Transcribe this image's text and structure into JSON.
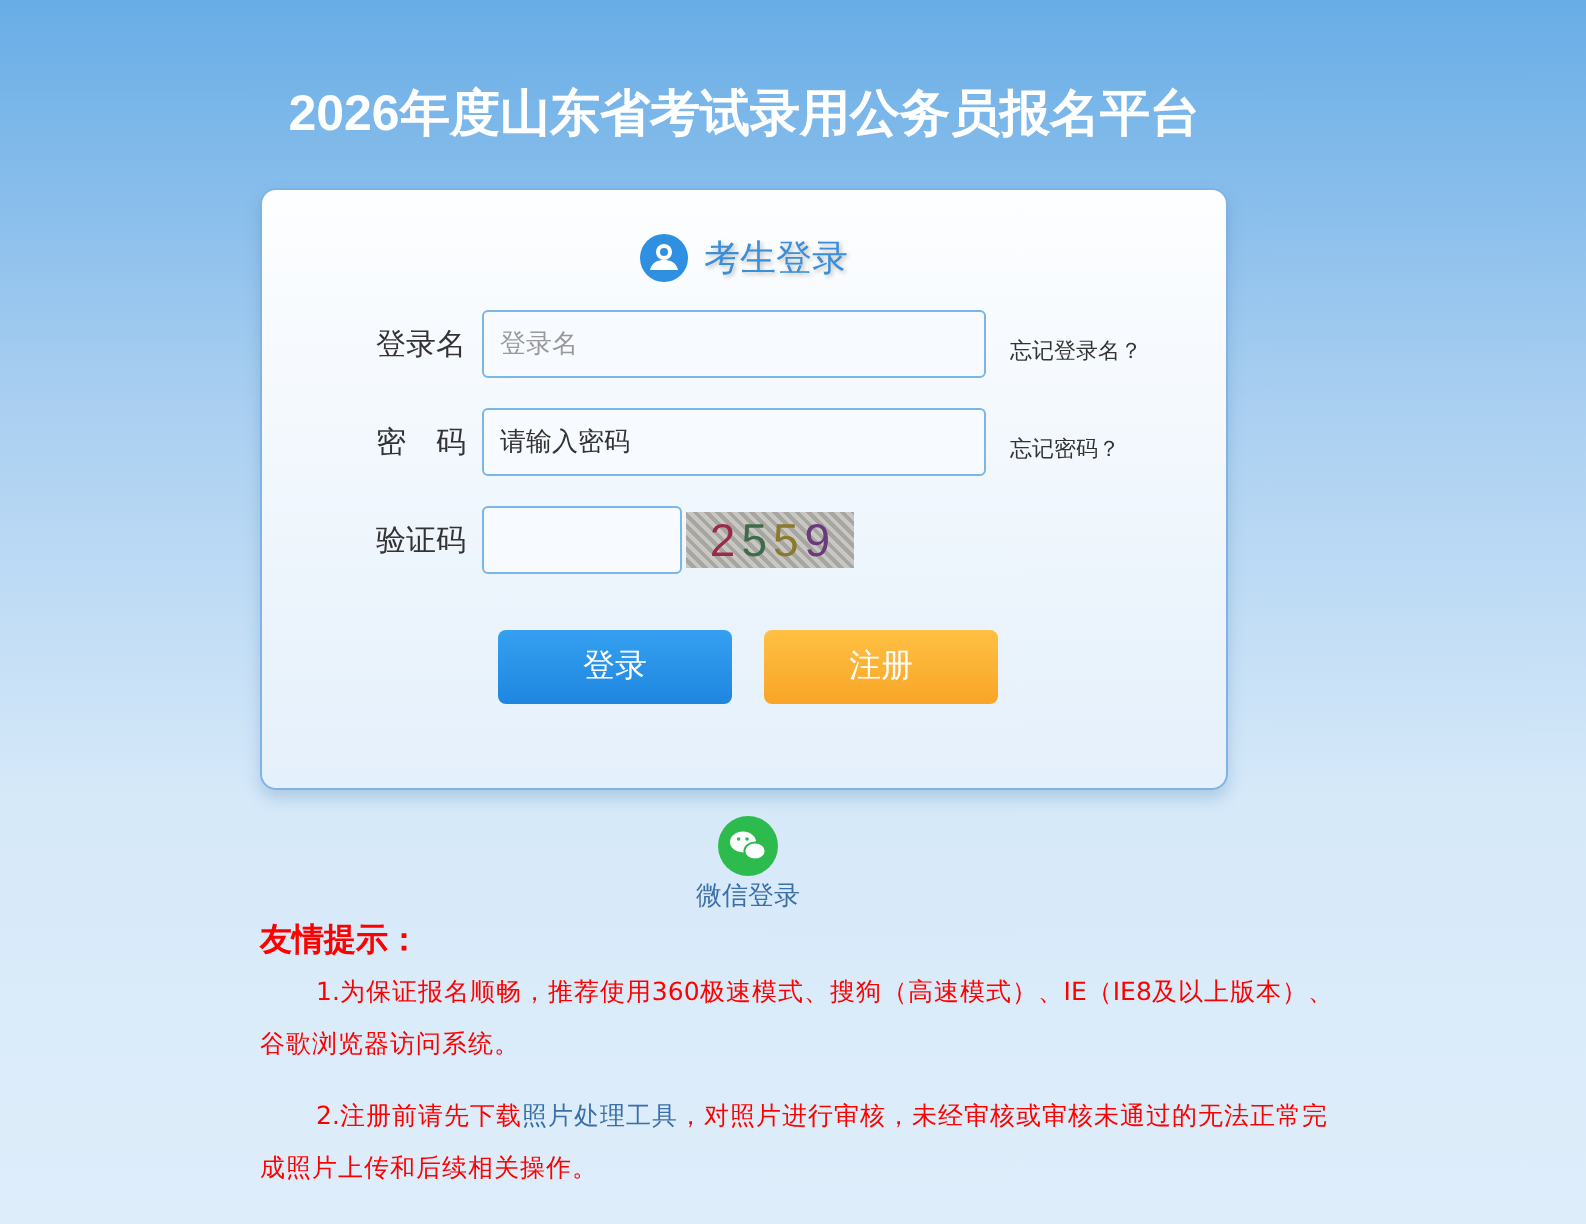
{
  "page_title": "2026年度山东省考试录用公务员报名平台",
  "login": {
    "heading": "考生登录",
    "fields": [
      {
        "kind": "text",
        "label": "登录名",
        "placeholder": "登录名",
        "help_link": "忘记登录名？"
      },
      {
        "kind": "password",
        "label": "密　码",
        "placeholder": "请输入密码",
        "help_link": "忘记密码？"
      },
      {
        "kind": "captcha",
        "label": "验证码",
        "captcha": "2559"
      }
    ],
    "buttons": [
      {
        "kind": "primary",
        "label": "登录"
      },
      {
        "kind": "secondary",
        "label": "注册"
      }
    ]
  },
  "wechat_login": "微信登录",
  "notice": {
    "title": "友情提示：",
    "items": [
      {
        "text_before": "1.为保证报名顺畅，推荐使用360极速模式、搜狗（高速模式）、IE（IE8及以上版本）、谷歌浏览器访问系统。"
      },
      {
        "text_before": "2.注册前请先下载",
        "link": "照片处理工具",
        "text_after": "，对照片进行审核，未经审核或审核未通过的无法正常完成照片上传和后续相关操作。"
      }
    ]
  }
}
